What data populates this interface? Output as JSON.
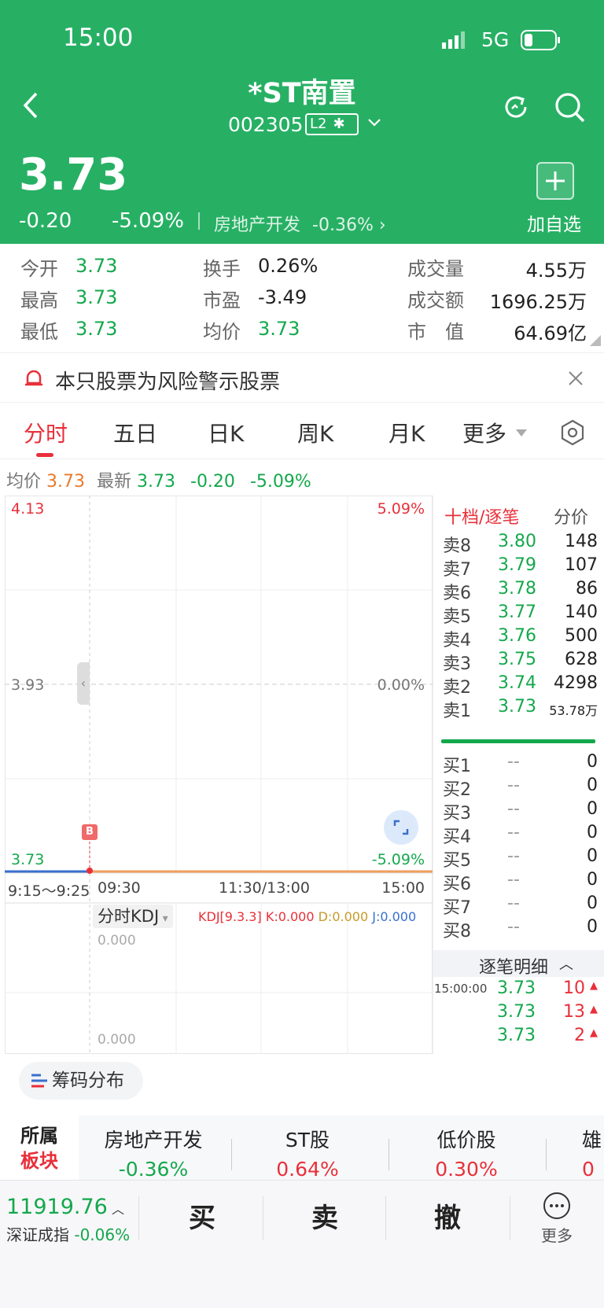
{
  "status": {
    "time": "15:00",
    "network": "5G"
  },
  "stock": {
    "name": "*ST南置",
    "code": "002305",
    "badge": "L2",
    "price": "3.73",
    "change": "-0.20",
    "change_pct": "-5.09%",
    "sector": "房地产开发",
    "sector_pct": "-0.36%",
    "watch_label": "加自选"
  },
  "stats": [
    {
      "label": "今开",
      "value": "3.73"
    },
    {
      "label": "换手",
      "value": "0.26%"
    },
    {
      "label": "成交量",
      "value": "4.55万"
    },
    {
      "label": "最高",
      "value": "3.73"
    },
    {
      "label": "市盈",
      "value": "-3.49"
    },
    {
      "label": "成交额",
      "value": "1696.25万"
    },
    {
      "label": "最低",
      "value": "3.73"
    },
    {
      "label": "均价",
      "value": "3.73"
    },
    {
      "label": "市　值",
      "value": "64.69亿"
    }
  ],
  "warning": "本只股票为风险警示股票",
  "tabs": [
    "分时",
    "五日",
    "日K",
    "周K",
    "月K",
    "更多"
  ],
  "summary": {
    "avg_label": "均价",
    "avg": "3.73",
    "latest_label": "最新",
    "latest": "3.73",
    "change": "-0.20",
    "pct": "-5.09%"
  },
  "chart": {
    "y_top": "4.13",
    "y_mid": "3.93",
    "y_bot": "3.73",
    "pct_top": "5.09%",
    "pct_mid": "0.00%",
    "pct_bot": "-5.09%",
    "x_labels": [
      "9:15～9:25",
      "09:30",
      "11:30/13:00",
      "15:00"
    ],
    "marker": "B"
  },
  "kdj": {
    "selector": "分时KDJ",
    "params": "KDJ[9.3.3]",
    "k": "K:0.000",
    "d": "D:0.000",
    "j": "J:0.000",
    "top": "0.000",
    "bot": "0.000"
  },
  "orderbook": {
    "title": "十档/逐笔",
    "price_mode": "分价",
    "asks": [
      [
        "卖8",
        "3.80",
        "148"
      ],
      [
        "卖7",
        "3.79",
        "107"
      ],
      [
        "卖6",
        "3.78",
        "86"
      ],
      [
        "卖5",
        "3.77",
        "140"
      ],
      [
        "卖4",
        "3.76",
        "500"
      ],
      [
        "卖3",
        "3.75",
        "628"
      ],
      [
        "卖2",
        "3.74",
        "4298"
      ],
      [
        "卖1",
        "3.73",
        "53.78万"
      ]
    ],
    "bids": [
      [
        "买1",
        "--",
        "0"
      ],
      [
        "买2",
        "--",
        "0"
      ],
      [
        "买3",
        "--",
        "0"
      ],
      [
        "买4",
        "--",
        "0"
      ],
      [
        "买5",
        "--",
        "0"
      ],
      [
        "买6",
        "--",
        "0"
      ],
      [
        "买7",
        "--",
        "0"
      ],
      [
        "买8",
        "--",
        "0"
      ]
    ],
    "tick_title": "逐笔明细",
    "ticks": [
      [
        "15:00:00",
        "3.73",
        "10"
      ],
      [
        "",
        "3.73",
        "13"
      ],
      [
        "",
        "3.73",
        "2"
      ]
    ]
  },
  "chip_button": "筹码分布",
  "sectors": {
    "title_line1": "所属",
    "title_line2": "板块",
    "items": [
      {
        "name": "房地产开发",
        "pct": "-0.36%"
      },
      {
        "name": "ST股",
        "pct": "0.64%"
      },
      {
        "name": "低价股",
        "pct": "0.30%"
      },
      {
        "name": "雄",
        "pct": "0"
      }
    ]
  },
  "bottom": {
    "index_value": "11919.76",
    "index_name": "深证成指",
    "index_pct": "-0.06%",
    "buy": "买",
    "sell": "卖",
    "cancel": "撤",
    "more": "更多"
  }
}
